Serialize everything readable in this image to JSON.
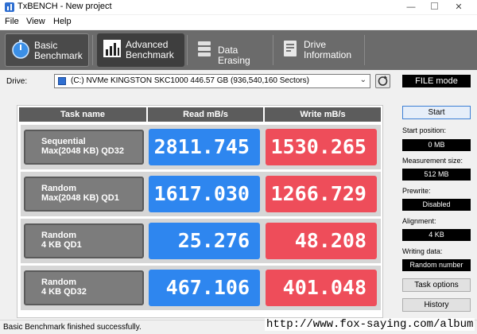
{
  "window": {
    "title": "TxBENCH - New project"
  },
  "menu": {
    "file": "File",
    "view": "View",
    "help": "Help"
  },
  "tabs": [
    {
      "line1": "Basic",
      "line2": "Benchmark",
      "icon": "stopwatch-icon"
    },
    {
      "line1": "Advanced",
      "line2": "Benchmark",
      "icon": "bar-chart-icon"
    },
    {
      "line1": "Data Erasing",
      "line2": "",
      "icon": "eraser-icon"
    },
    {
      "line1": "Drive",
      "line2": "Information",
      "icon": "drive-info-icon"
    }
  ],
  "drive": {
    "label": "Drive:",
    "value": "(C:) NVMe KINGSTON SKC1000  446.57 GB (936,540,160 Sectors)",
    "mode": "FILE mode"
  },
  "table": {
    "headers": {
      "task": "Task name",
      "read": "Read mB/s",
      "write": "Write mB/s"
    },
    "rows": [
      {
        "line1": "Sequential",
        "line2": "Max(2048 KB) QD32",
        "read": "2811.745",
        "write": "1530.265"
      },
      {
        "line1": "Random",
        "line2": "Max(2048 KB) QD1",
        "read": "1617.030",
        "write": "1266.729"
      },
      {
        "line1": "Random",
        "line2": "4 KB QD1",
        "read": "25.276",
        "write": "48.208"
      },
      {
        "line1": "Random",
        "line2": "4 KB QD32",
        "read": "467.106",
        "write": "401.048"
      }
    ]
  },
  "side": {
    "start": "Start",
    "start_position_label": "Start position:",
    "start_position": "0 MB",
    "measurement_size_label": "Measurement size:",
    "measurement_size": "512 MB",
    "prewrite_label": "Prewrite:",
    "prewrite": "Disabled",
    "alignment_label": "Alignment:",
    "alignment": "4 KB",
    "writing_data_label": "Writing data:",
    "writing_data": "Random number",
    "task_options": "Task options",
    "history": "History"
  },
  "status": {
    "text": "Basic Benchmark finished successfully."
  },
  "watermark": "http://www.fox-saying.com/album",
  "colors": {
    "read": "#2e86ef",
    "write": "#ee4d5a",
    "toolbar": "#6b6b6b"
  }
}
